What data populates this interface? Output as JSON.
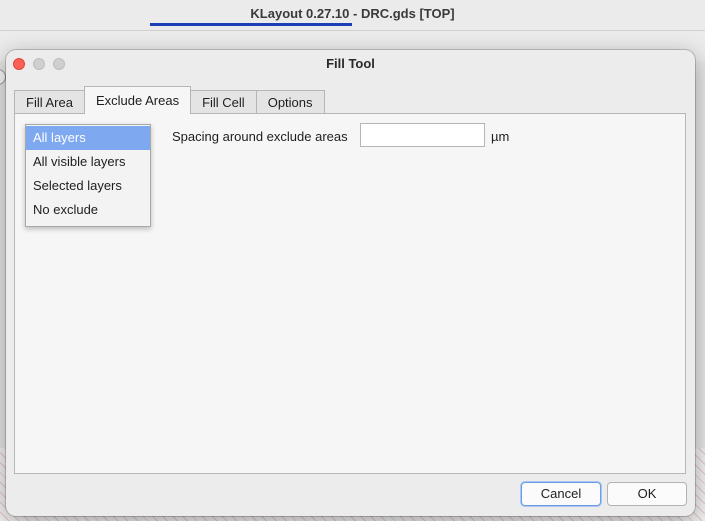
{
  "main_window": {
    "title": "KLayout 0.27.10 - DRC.gds [TOP]"
  },
  "dialog": {
    "title": "Fill Tool",
    "tabs": [
      {
        "label": "Fill Area",
        "active": false
      },
      {
        "label": "Exclude Areas",
        "active": true
      },
      {
        "label": "Fill Cell",
        "active": false
      },
      {
        "label": "Options",
        "active": false
      }
    ],
    "exclude_dropdown": {
      "options": [
        "All layers",
        "All visible layers",
        "Selected layers",
        "No exclude"
      ],
      "highlighted": "All layers"
    },
    "spacing": {
      "label": "Spacing around exclude areas",
      "value": "",
      "unit": "µm"
    },
    "buttons": {
      "cancel": "Cancel",
      "ok": "OK"
    }
  },
  "colors": {
    "selection_highlight": "#7ea8f0",
    "close_button": "#fe5f57",
    "title_underline": "#1a3fb8"
  }
}
